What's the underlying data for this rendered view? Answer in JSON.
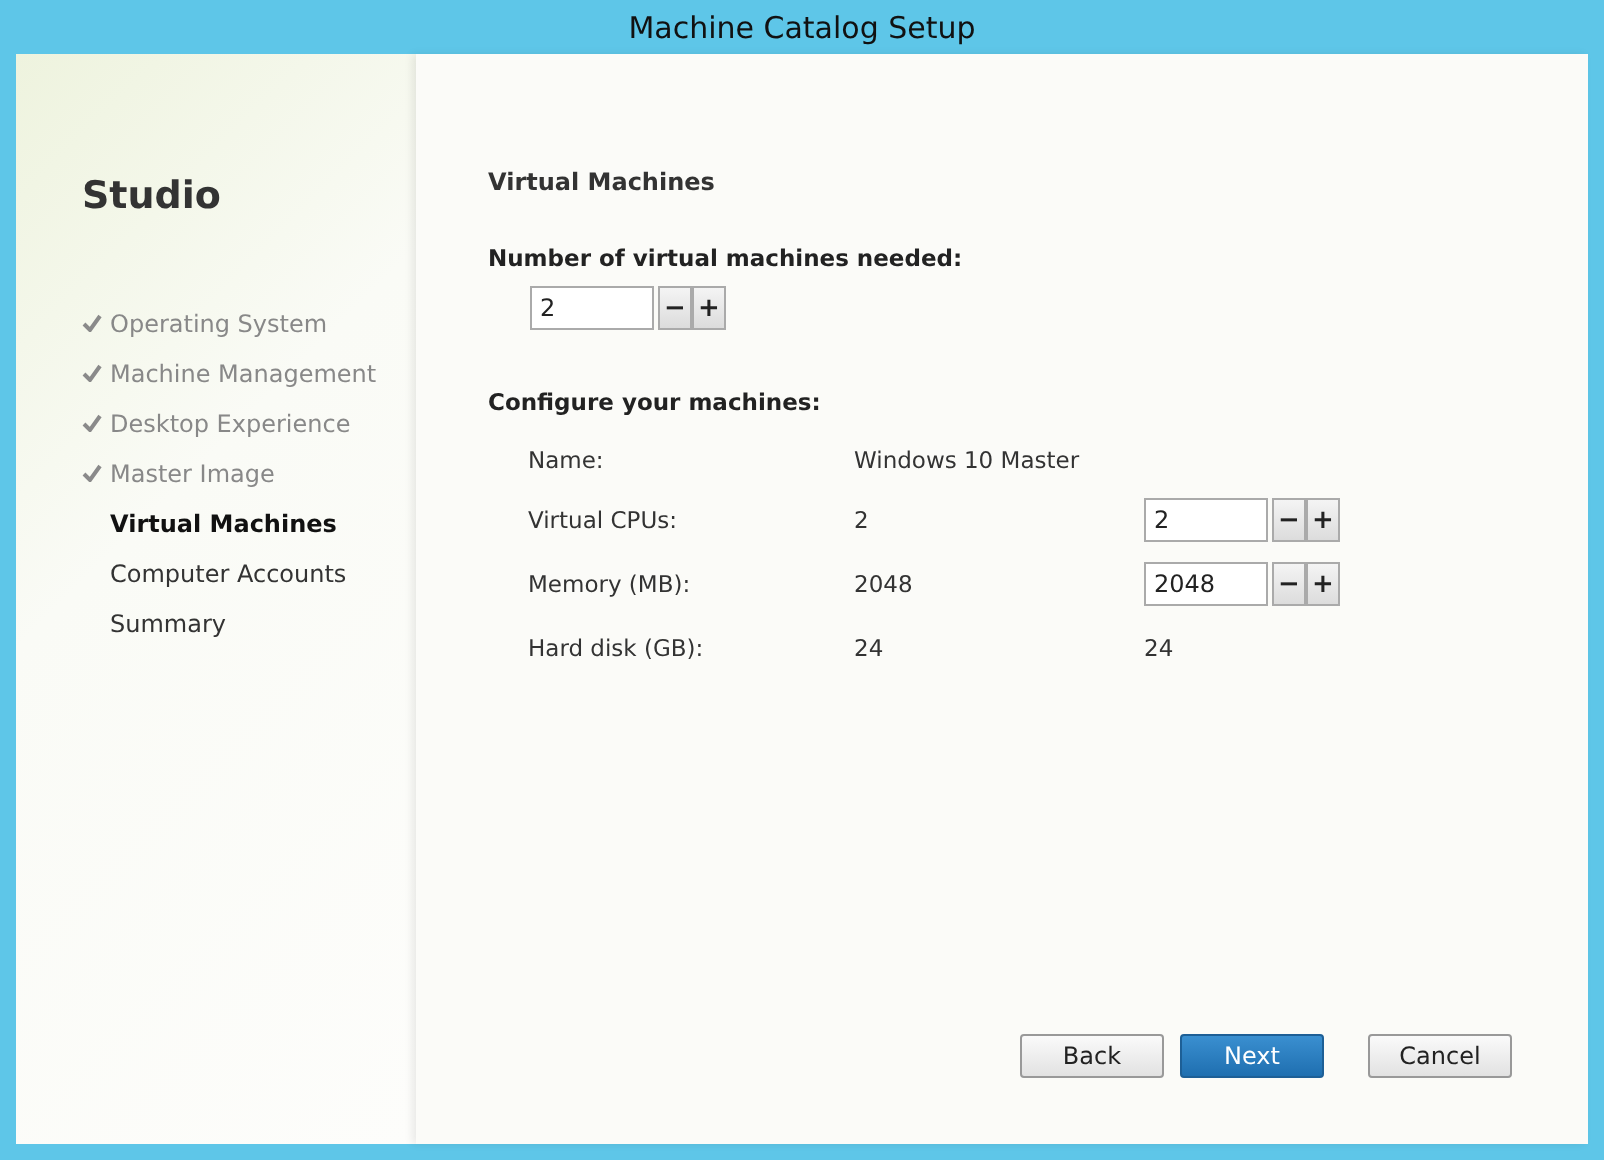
{
  "window": {
    "title": "Machine Catalog Setup"
  },
  "sidebar": {
    "title": "Studio",
    "steps": [
      {
        "label": "Operating System",
        "done": true,
        "selected": false
      },
      {
        "label": "Machine Management",
        "done": true,
        "selected": false
      },
      {
        "label": "Desktop Experience",
        "done": true,
        "selected": false
      },
      {
        "label": "Master Image",
        "done": true,
        "selected": false
      },
      {
        "label": "Virtual Machines",
        "done": false,
        "selected": true
      },
      {
        "label": "Computer Accounts",
        "done": false,
        "selected": false
      },
      {
        "label": "Summary",
        "done": false,
        "selected": false
      }
    ]
  },
  "page": {
    "heading": "Virtual Machines",
    "count_label": "Number of virtual machines needed:",
    "count_value": "2",
    "configure_label": "Configure your machines:",
    "rows": [
      {
        "label": "Name:",
        "value": "Windows 10 Master",
        "kind": "none"
      },
      {
        "label": "Virtual CPUs:",
        "value": "2",
        "kind": "spinner",
        "setting": "2"
      },
      {
        "label": "Memory (MB):",
        "value": "2048",
        "kind": "spinner",
        "setting": "2048"
      },
      {
        "label": "Hard disk (GB):",
        "value": "24",
        "kind": "text",
        "setting": "24"
      }
    ]
  },
  "spinner_glyphs": {
    "minus": "−",
    "plus": "+"
  },
  "buttons": [
    {
      "label": "Back",
      "primary": false
    },
    {
      "label": "Next",
      "primary": true
    },
    {
      "label": "Cancel",
      "primary": false
    }
  ]
}
